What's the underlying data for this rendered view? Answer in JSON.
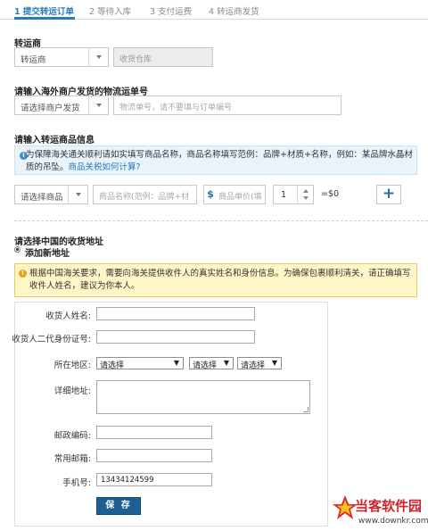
{
  "steps": [
    {
      "label": "1 提交转运订单",
      "active": true
    },
    {
      "label": "2 等待入库",
      "active": false
    },
    {
      "label": "3 支付运费",
      "active": false
    },
    {
      "label": "4 转运商发货",
      "active": false
    }
  ],
  "forwarder": {
    "label": "转运商",
    "select_value": "转运商",
    "warehouse_placeholder": "收货仓库"
  },
  "tracking": {
    "label": "请输入海外商户发货的物流运单号",
    "merchant_select": "请选择商户发货",
    "tracking_placeholder": "物流单号，请不要填与订单编号"
  },
  "goods": {
    "label": "请输入转运商品信息",
    "info_text": "为保障海关通关顺利请如实填写商品名称，商品名称填写范例：品牌+材质+名称，例如：某品牌水晶材质的吊坠。",
    "info_link": "商品关税如何计算?",
    "category_select": "请选择商品",
    "name_placeholder": "商品名称(范例：品牌+材",
    "price_icon": "$",
    "price_placeholder": "商品单价(填",
    "quantity": "1",
    "total": "=$0",
    "add_icon": "+"
  },
  "address": {
    "label": "请选择中国的收货地址",
    "add_new": "添加新地址",
    "warning_text": "根据中国海关要求，需要向海关提供收件人的真实姓名和身份信息。为确保包裹顺利清关，请正确填写收件人姓名，建议为你本人。",
    "fields": {
      "name_label": "收货人姓名:",
      "id_label": "收货人二代身份证号:",
      "region_label": "所在地区:",
      "region_select_1": "请选择",
      "region_select_2": "请选择",
      "region_select_3": "请选择",
      "detail_label": "详细地址:",
      "zip_label": "邮政编码:",
      "email_label": "常用邮箱:",
      "phone_label": "手机号:",
      "phone_value": "13434124599"
    },
    "save_label": "保 存"
  },
  "watermark": {
    "title": "当客软件园",
    "url": "www.downkr.com"
  },
  "colors": {
    "accent": "#2a7ab8",
    "save_button": "#1e5f93",
    "info_bg": "#e9f3fb",
    "warning_bg": "#fff6c7",
    "watermark_red": "#d2232a"
  }
}
